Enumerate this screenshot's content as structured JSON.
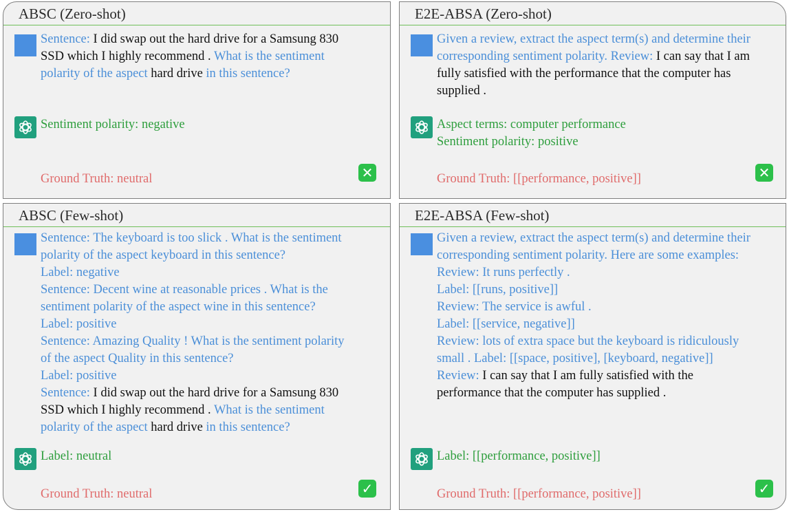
{
  "panels": [
    {
      "title": "ABSC (Zero-shot)",
      "prompt": [
        [
          [
            "b",
            "Sentence:"
          ],
          [
            "k",
            " I did swap out the hard drive for a Samsung 830"
          ]
        ],
        [
          [
            "k",
            "SSD which I highly recommend . "
          ],
          [
            "b",
            "What is the sentiment"
          ]
        ],
        [
          [
            "b",
            "polarity of the aspect "
          ],
          [
            "k",
            "hard drive"
          ],
          [
            "b",
            " in this sentence?"
          ]
        ]
      ],
      "answer": [
        "Sentiment polarity: negative"
      ],
      "ground_truth": "Ground Truth: neutral",
      "verdict": "wrong",
      "verdict_icon": "cross-mark-icon"
    },
    {
      "title": "E2E-ABSA (Zero-shot)",
      "prompt": [
        [
          [
            "b",
            "Given a review, extract the aspect term(s) and determine their"
          ]
        ],
        [
          [
            "b",
            "corresponding sentiment polarity. Review:"
          ],
          [
            "k",
            " I can say that I am"
          ]
        ],
        [
          [
            "k",
            "fully satisfied with the performance that the computer has"
          ]
        ],
        [
          [
            "k",
            "supplied ."
          ]
        ]
      ],
      "answer": [
        "Aspect terms: computer performance",
        "Sentiment polarity: positive"
      ],
      "ground_truth": "Ground Truth: [[performance, positive]]",
      "verdict": "wrong",
      "verdict_icon": "cross-mark-icon"
    },
    {
      "title": "ABSC (Few-shot)",
      "prompt": [
        [
          [
            "b",
            "Sentence: The keyboard is too slick . What is the sentiment"
          ]
        ],
        [
          [
            "b",
            "polarity of the aspect keyboard in this sentence?"
          ]
        ],
        [
          [
            "b",
            "Label: negative"
          ]
        ],
        [
          [
            "b",
            "Sentence: Decent wine at reasonable prices . What is the"
          ]
        ],
        [
          [
            "b",
            "sentiment polarity of the aspect wine in this sentence?"
          ]
        ],
        [
          [
            "b",
            "Label: positive"
          ]
        ],
        [
          [
            "b",
            "Sentence: Amazing Quality !  What is the sentiment polarity"
          ]
        ],
        [
          [
            "b",
            "of the aspect Quality in this sentence?"
          ]
        ],
        [
          [
            "b",
            "Label: positive"
          ]
        ],
        [
          [
            "b",
            "Sentence:"
          ],
          [
            "k",
            " I did swap out the hard drive for a Samsung 830"
          ]
        ],
        [
          [
            "k",
            "SSD which I highly recommend . "
          ],
          [
            "b",
            "What is the sentiment"
          ]
        ],
        [
          [
            "b",
            "polarity of the aspect "
          ],
          [
            "k",
            "hard drive"
          ],
          [
            "b",
            " in this sentence?"
          ]
        ]
      ],
      "answer": [
        "Label: neutral"
      ],
      "ground_truth": "Ground Truth: neutral",
      "verdict": "right",
      "verdict_icon": "check-mark-icon"
    },
    {
      "title": "E2E-ABSA (Few-shot)",
      "prompt": [
        [
          [
            "b",
            "Given a review, extract the aspect term(s) and determine their"
          ]
        ],
        [
          [
            "b",
            "corresponding sentiment polarity. Here are some examples:"
          ]
        ],
        [
          [
            "b",
            "Review:  It runs perfectly ."
          ]
        ],
        [
          [
            "b",
            "Label: [[runs, positive]]"
          ]
        ],
        [
          [
            "b",
            "Review: The service is awful ."
          ]
        ],
        [
          [
            "b",
            "Label: [[service, negative]]"
          ]
        ],
        [
          [
            "b",
            "Review:  lots of extra space but the keyboard is ridiculously"
          ]
        ],
        [
          [
            "b",
            "small . Label: [[space, positive], [keyboard, negative]]"
          ]
        ],
        [
          [
            "b",
            "Review:"
          ],
          [
            "k",
            " I can say that I am fully satisfied with the"
          ]
        ],
        [
          [
            "k",
            "performance that the computer has supplied ."
          ]
        ]
      ],
      "answer": [
        "Label: [[performance, positive]]"
      ],
      "ground_truth": "Ground Truth: [[performance, positive]]",
      "verdict": "right",
      "verdict_icon": "check-mark-icon"
    }
  ],
  "colors": {
    "panel_bg": "#f1f1f1",
    "title_rule": "#6fbf59",
    "prompt_blue": "#4b8fd8",
    "answer_green": "#2e9e3d",
    "ground_truth_red": "#e06b6b",
    "user_avatar": "#4a8fe0",
    "bot_avatar": "#21a07e",
    "verdict_badge": "#2cc04a"
  }
}
